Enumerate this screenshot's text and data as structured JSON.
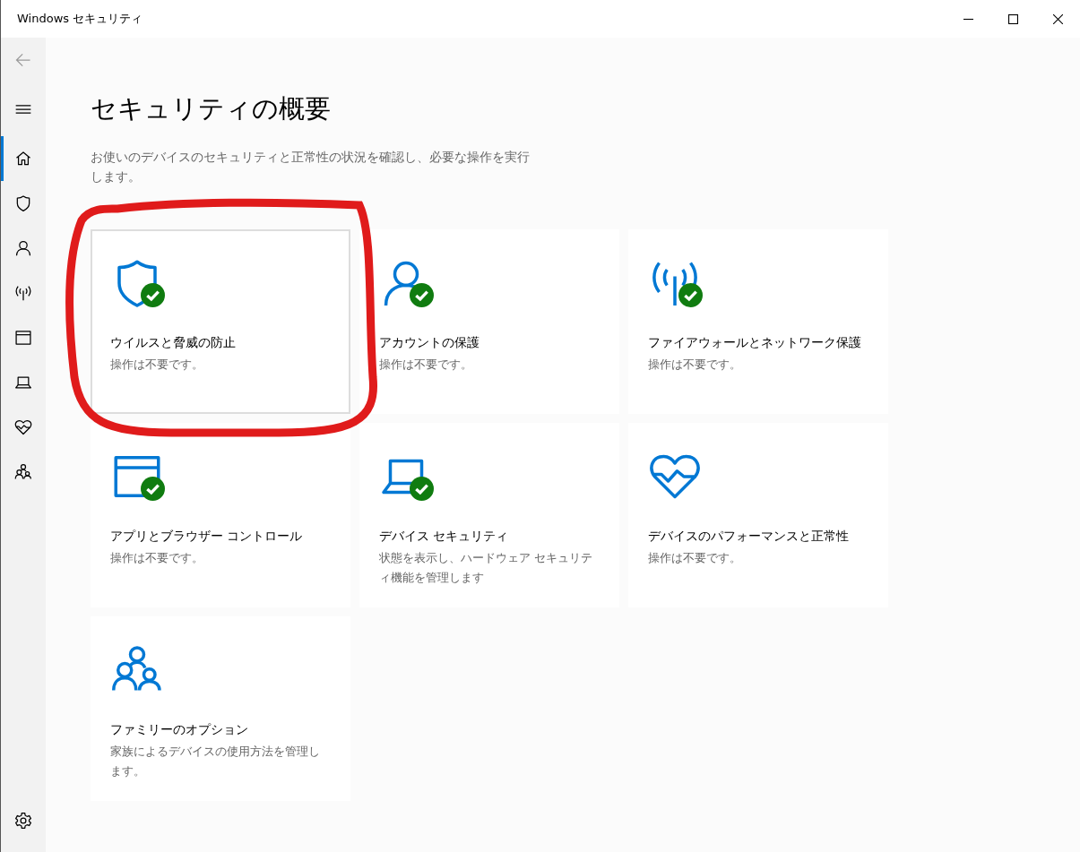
{
  "window": {
    "title": "Windows セキュリティ"
  },
  "nav": [
    {
      "kind": "home",
      "selected": true
    },
    {
      "kind": "shield",
      "selected": false
    },
    {
      "kind": "person",
      "selected": false
    },
    {
      "kind": "antenna",
      "selected": false
    },
    {
      "kind": "browser",
      "selected": false
    },
    {
      "kind": "laptop",
      "selected": false
    },
    {
      "kind": "heart",
      "selected": false
    },
    {
      "kind": "family",
      "selected": false
    }
  ],
  "page": {
    "title": "セキュリティの概要",
    "description": "お使いのデバイスのセキュリティと正常性の状況を確認し、必要な操作を実行します。"
  },
  "cards": [
    {
      "kind": "shield",
      "title": "ウイルスと脅威の防止",
      "status": "操作は不要です。",
      "ok": true,
      "hovered": true,
      "circled": true
    },
    {
      "kind": "person",
      "title": "アカウントの保護",
      "status": "操作は不要です。",
      "ok": true,
      "hovered": false,
      "circled": false
    },
    {
      "kind": "antenna",
      "title": "ファイアウォールとネットワーク保護",
      "status": "操作は不要です。",
      "ok": true,
      "hovered": false,
      "circled": false
    },
    {
      "kind": "browser",
      "title": "アプリとブラウザー コントロール",
      "status": "操作は不要です。",
      "ok": true,
      "hovered": false,
      "circled": false
    },
    {
      "kind": "laptop",
      "title": "デバイス セキュリティ",
      "status": "状態を表示し、ハードウェア セキュリティ機能を管理します",
      "ok": true,
      "hovered": false,
      "circled": false
    },
    {
      "kind": "heart",
      "title": "デバイスのパフォーマンスと正常性",
      "status": "操作は不要です。",
      "ok": false,
      "hovered": false,
      "circled": false
    },
    {
      "kind": "family",
      "title": "ファミリーのオプション",
      "status": "家族によるデバイスの使用方法を管理します。",
      "ok": false,
      "hovered": false,
      "circled": false
    }
  ]
}
